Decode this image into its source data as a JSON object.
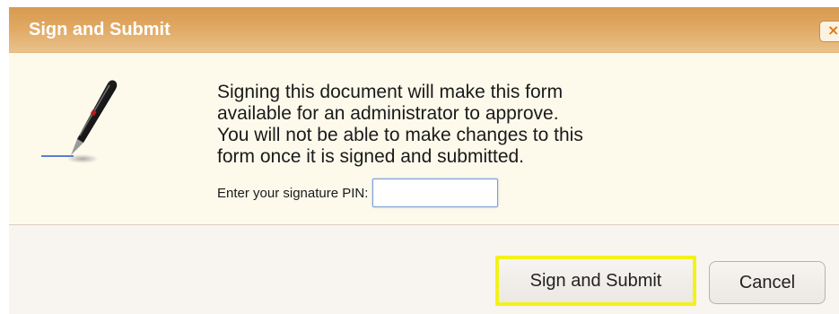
{
  "dialog": {
    "title": "Sign and Submit",
    "close_glyph": "×"
  },
  "icon": {
    "name": "pen-icon"
  },
  "message": {
    "lines": [
      "Signing this document will make this form",
      "available for an administrator to approve.",
      "You will not be able to make changes to this",
      "form once it is signed and submitted."
    ]
  },
  "pin": {
    "label": "Enter your signature PIN:",
    "value": "",
    "placeholder": ""
  },
  "buttons": {
    "sign_label": "Sign and Submit",
    "cancel_label": "Cancel"
  },
  "colors": {
    "titlebar": "#e0a862",
    "content_bg": "#fdfaec",
    "highlight": "#f2f21a"
  }
}
